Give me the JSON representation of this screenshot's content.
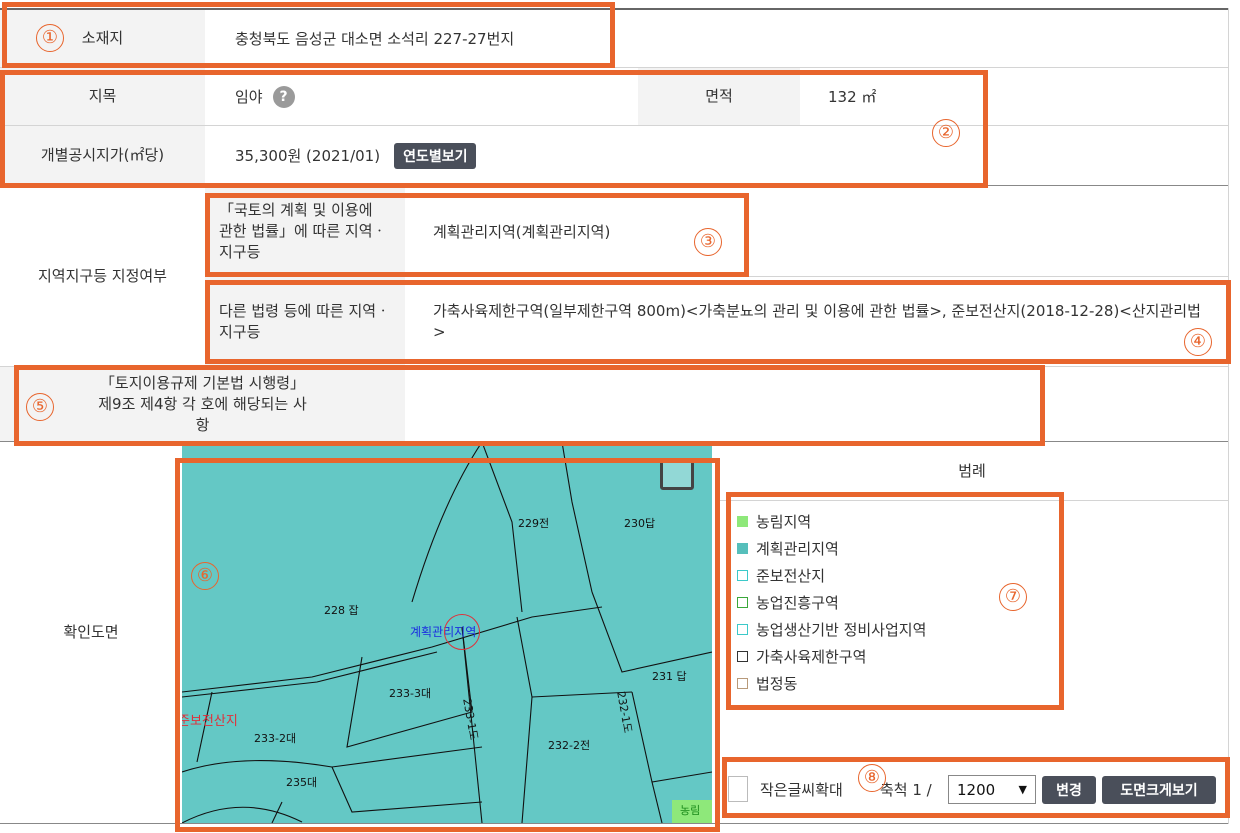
{
  "location": {
    "label": "소재지",
    "value": "충청북도 음성군 대소면 소석리 227-27번지"
  },
  "land_category": {
    "label": "지목",
    "value": "임야",
    "help_icon": "question-icon"
  },
  "area": {
    "label": "면적",
    "value": "132 ㎡"
  },
  "official_price": {
    "label": "개별공시지가(㎡당)",
    "value": "35,300원 (2021/01)",
    "button": "연도별보기"
  },
  "zoning": {
    "label": "지역지구등 지정여부",
    "national_law_label": "「국토의 계획 및 이용에 관한 법률」에 따른 지역ㆍ지구등",
    "national_law_value": "계획관리지역(계획관리지역)",
    "other_law_label": "다른 법령 등에 따른 지역ㆍ지구등",
    "other_law_value": "가축사육제한구역(일부제한구역 800m)<가축분뇨의 관리 및 이용에 관한 법률>, 준보전산지(2018-12-28)<산지관리법>"
  },
  "regulation": {
    "label": "「토지이용규제 기본법 시행령」 제9조 제4항 각 호에 해당되는 사항",
    "value": ""
  },
  "map": {
    "label": "확인도면",
    "parcels": [
      "229전",
      "230답",
      "228 잡",
      "233-3대",
      "231 답",
      "233-1도",
      "232-1도",
      "232-2전",
      "233-2대",
      "235대"
    ],
    "zone_label": "계획관리지역",
    "forest_label": "준보전산지",
    "corner_label": "농림"
  },
  "legend": {
    "title": "범례",
    "items": [
      {
        "label": "농림지역",
        "color": "#8ee87a",
        "fill": true
      },
      {
        "label": "계획관리지역",
        "color": "#56bfbb",
        "fill": true
      },
      {
        "label": "준보전산지",
        "color": "#3cc9c9",
        "fill": false
      },
      {
        "label": "농업진흥구역",
        "color": "#3aa83a",
        "fill": false
      },
      {
        "label": "농업생산기반 정비사업지역",
        "color": "#3cc9c9",
        "fill": false
      },
      {
        "label": "가축사육제한구역",
        "color": "#333333",
        "fill": false
      },
      {
        "label": "법정동",
        "color": "#b89a7a",
        "fill": false
      }
    ]
  },
  "controls": {
    "large_text_label": "작은글씨확대",
    "scale_label": "축척 1 /",
    "scale_value": "1200",
    "change_button": "변경",
    "enlarge_button": "도면크게보기"
  },
  "markers": [
    "①",
    "②",
    "③",
    "④",
    "⑤",
    "⑥",
    "⑦",
    "⑧"
  ],
  "colors": {
    "accent": "#e8652d",
    "map_fill": "#64c8c5",
    "label_bg": "#f3f3f3"
  }
}
